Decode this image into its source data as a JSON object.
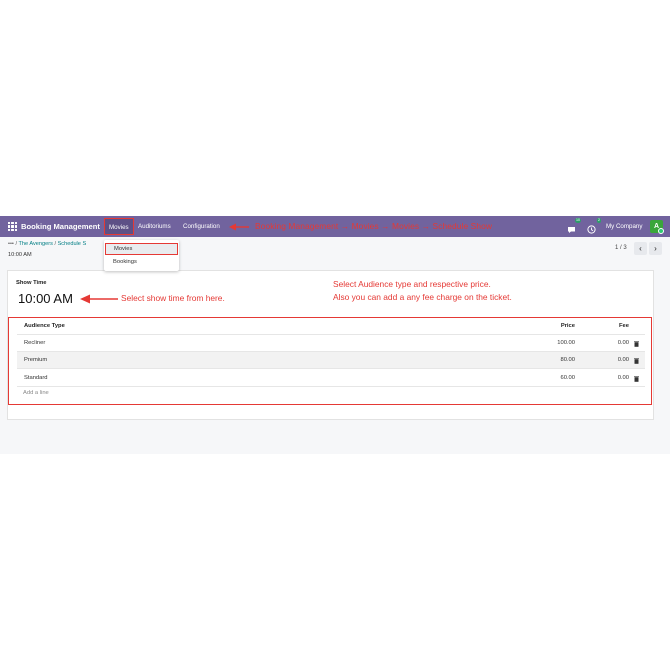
{
  "navbar": {
    "brand": "Booking Management",
    "menus": [
      "Movies",
      "Auditoriums",
      "Configuration"
    ],
    "annotation": "Booking Management  →  Movies  →  Movies  →  Schedule Show",
    "chat_badge": "10",
    "activity_badge": "2",
    "company": "My Company",
    "avatar_letter": "A"
  },
  "breadcrumb": {
    "dots": "•••",
    "sep": "/",
    "items": [
      "The Avengers",
      "Schedule S"
    ],
    "current": "10:00 AM"
  },
  "pager": {
    "text": "1 / 3",
    "prev": "‹",
    "next": "›"
  },
  "dropdown": {
    "items": [
      "Movies",
      "Bookings"
    ]
  },
  "form": {
    "show_time_label": "Show Time",
    "show_time_value": "10:00 AM",
    "note_left": "Select show time from here.",
    "note_right_1": "Select Audience type and respective price.",
    "note_right_2": "Also you can add a any fee charge on the ticket."
  },
  "table": {
    "headers": {
      "type": "Audience Type",
      "price": "Price",
      "fee": "Fee"
    },
    "rows": [
      {
        "type": "Recliner",
        "price": "100.00",
        "fee": "0.00"
      },
      {
        "type": "Premium",
        "price": "80.00",
        "fee": "0.00"
      },
      {
        "type": "Standard",
        "price": "60.00",
        "fee": "0.00"
      }
    ],
    "add_line": "Add a line"
  },
  "colors": {
    "navbar": "#71639e",
    "annotation": "#e53935",
    "link": "#017e84"
  }
}
